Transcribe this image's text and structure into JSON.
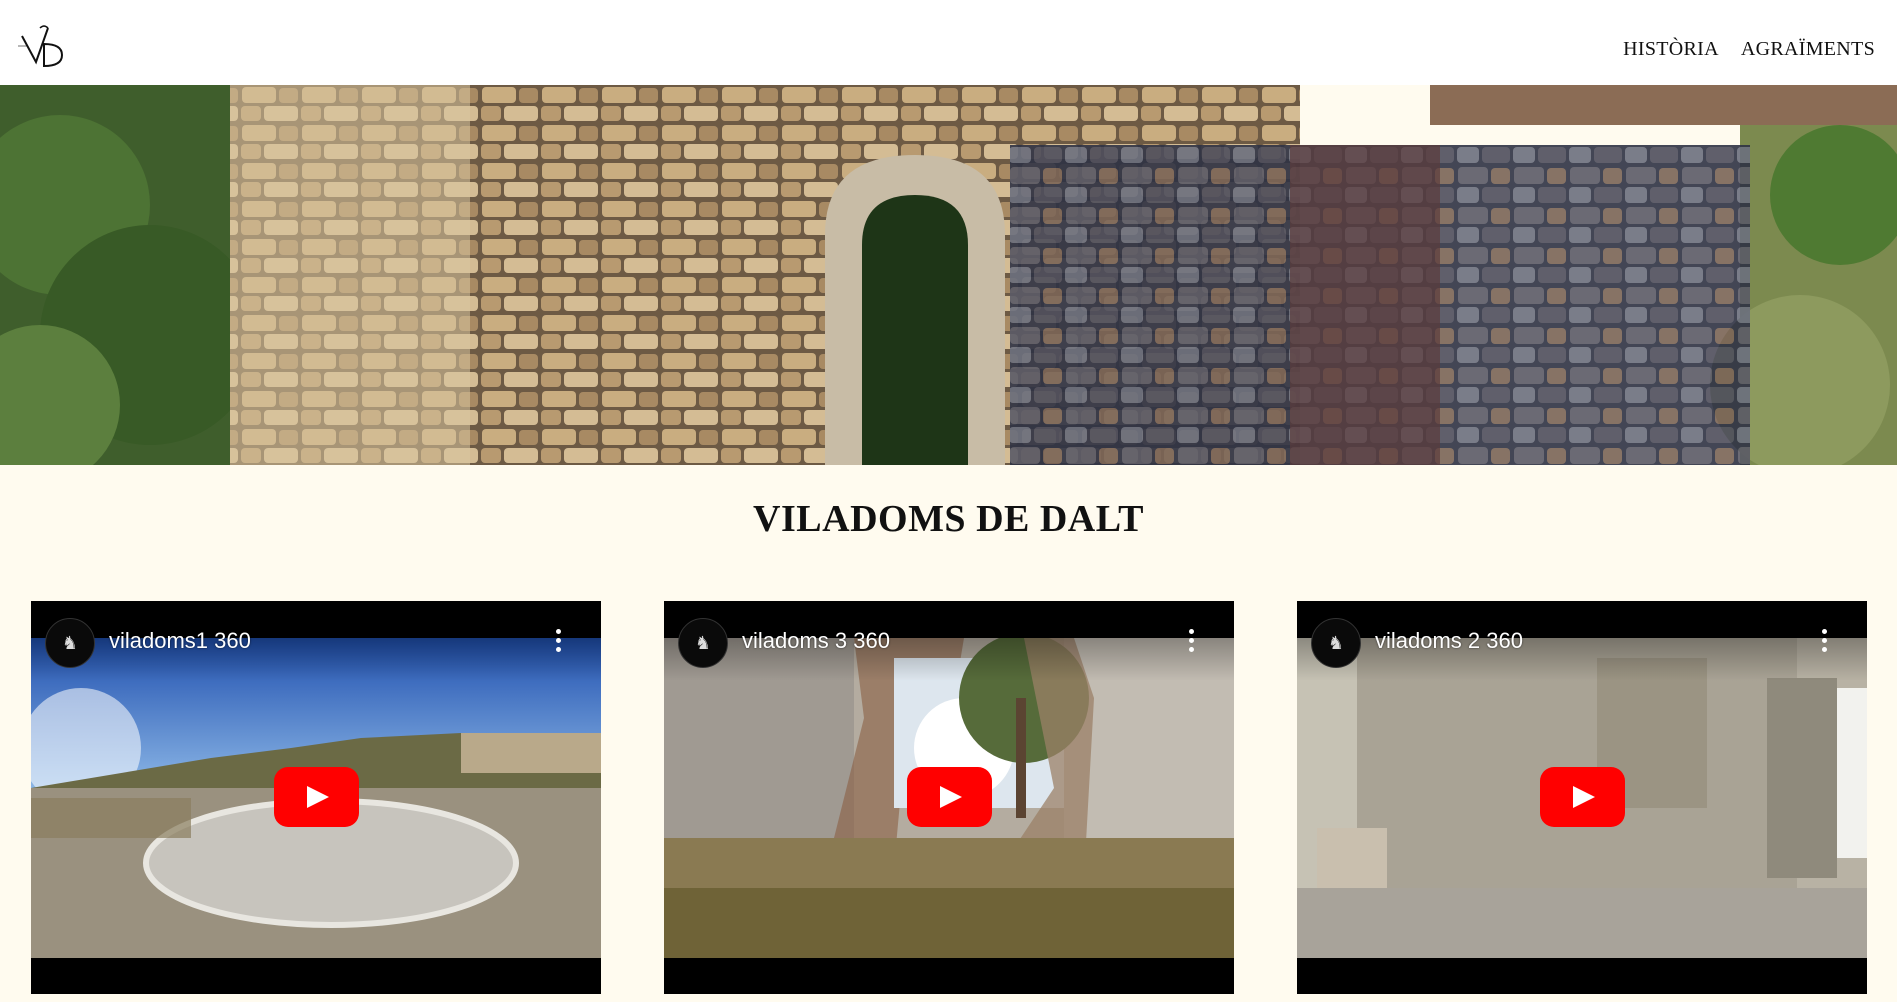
{
  "header": {
    "logo_alt": "VD monogram",
    "nav": [
      {
        "label": "HISTÒRIA"
      },
      {
        "label": "AGRAÏMENTS"
      }
    ]
  },
  "hero": {
    "icon": "stone-wall-ruins-photo"
  },
  "main": {
    "title": "VILADOMS DE DALT"
  },
  "videos": [
    {
      "title": "viladoms1 360",
      "channel_icon": "channel-avatar-icon",
      "menu_icon": "more-vert-icon"
    },
    {
      "title": "viladoms 3 360",
      "channel_icon": "channel-avatar-icon",
      "menu_icon": "more-vert-icon"
    },
    {
      "title": "viladoms 2 360",
      "channel_icon": "channel-avatar-icon",
      "menu_icon": "more-vert-icon"
    }
  ],
  "colors": {
    "page_background": "#fffbef",
    "header_background": "#ffffff",
    "youtube_red": "#ff0000"
  }
}
